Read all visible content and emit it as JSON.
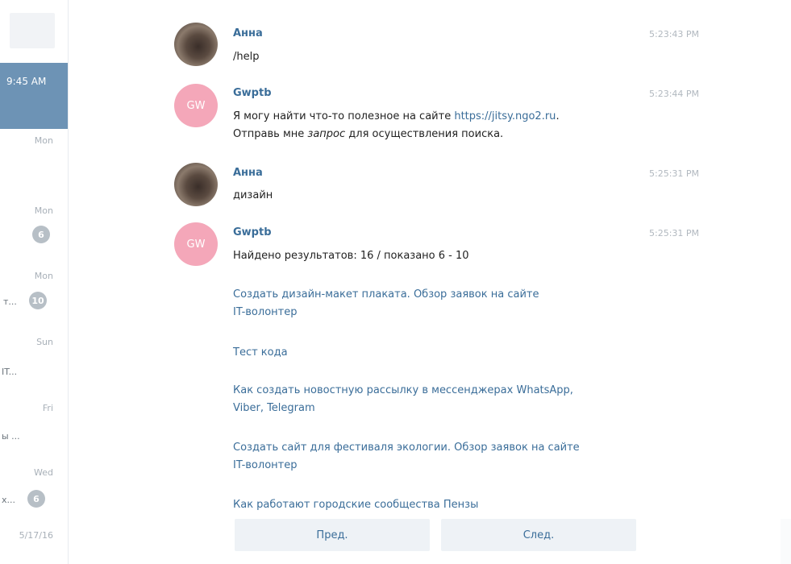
{
  "sidebar": {
    "active_time": "9:45 AM",
    "dates": [
      "Mon",
      "Mon",
      "Mon",
      "Sun",
      "Fri",
      "Wed",
      "5/17/16"
    ],
    "snippets": [
      "т...",
      "IT...",
      "ы ...",
      "х..."
    ],
    "badges": [
      "6",
      "10",
      "6"
    ]
  },
  "messages": [
    {
      "sender": "Анна",
      "time": "5:23:43 PM",
      "text": "/help"
    },
    {
      "sender": "Gwptb",
      "avatar_initials": "GW",
      "time": "5:23:44 PM",
      "line1_prefix": "Я могу найти что-то полезное на сайте ",
      "line1_link": "https://jitsy.ngo2.ru",
      "line1_suffix": ".",
      "line2_prefix": "Отправь мне ",
      "line2_em": "запрос",
      "line2_suffix": " для осуществления поиска."
    },
    {
      "sender": "Анна",
      "time": "5:25:31 PM",
      "text": "дизайн"
    },
    {
      "sender": "Gwptb",
      "avatar_initials": "GW",
      "time": "5:25:31 PM",
      "text": "Найдено результатов: 16 / показано 6 - 10",
      "results": [
        {
          "line1": "Создать дизайн-макет плаката. Обзор заявок на сайте",
          "line2": "IT-волонтер"
        },
        {
          "line1": "Тест кода",
          "line2": ""
        },
        {
          "line1": "Как создать новостную рассылку в мессенджерах WhatsApp,",
          "line2": "Viber, Telegram"
        },
        {
          "line1": "Создать сайт для фестиваля экологии. Обзор заявок на сайте",
          "line2": "IT-волонтер"
        },
        {
          "line1": "Как работают городские сообщества Пензы",
          "line2": ""
        }
      ]
    }
  ],
  "buttons": {
    "prev": "Пред.",
    "next": "След."
  }
}
